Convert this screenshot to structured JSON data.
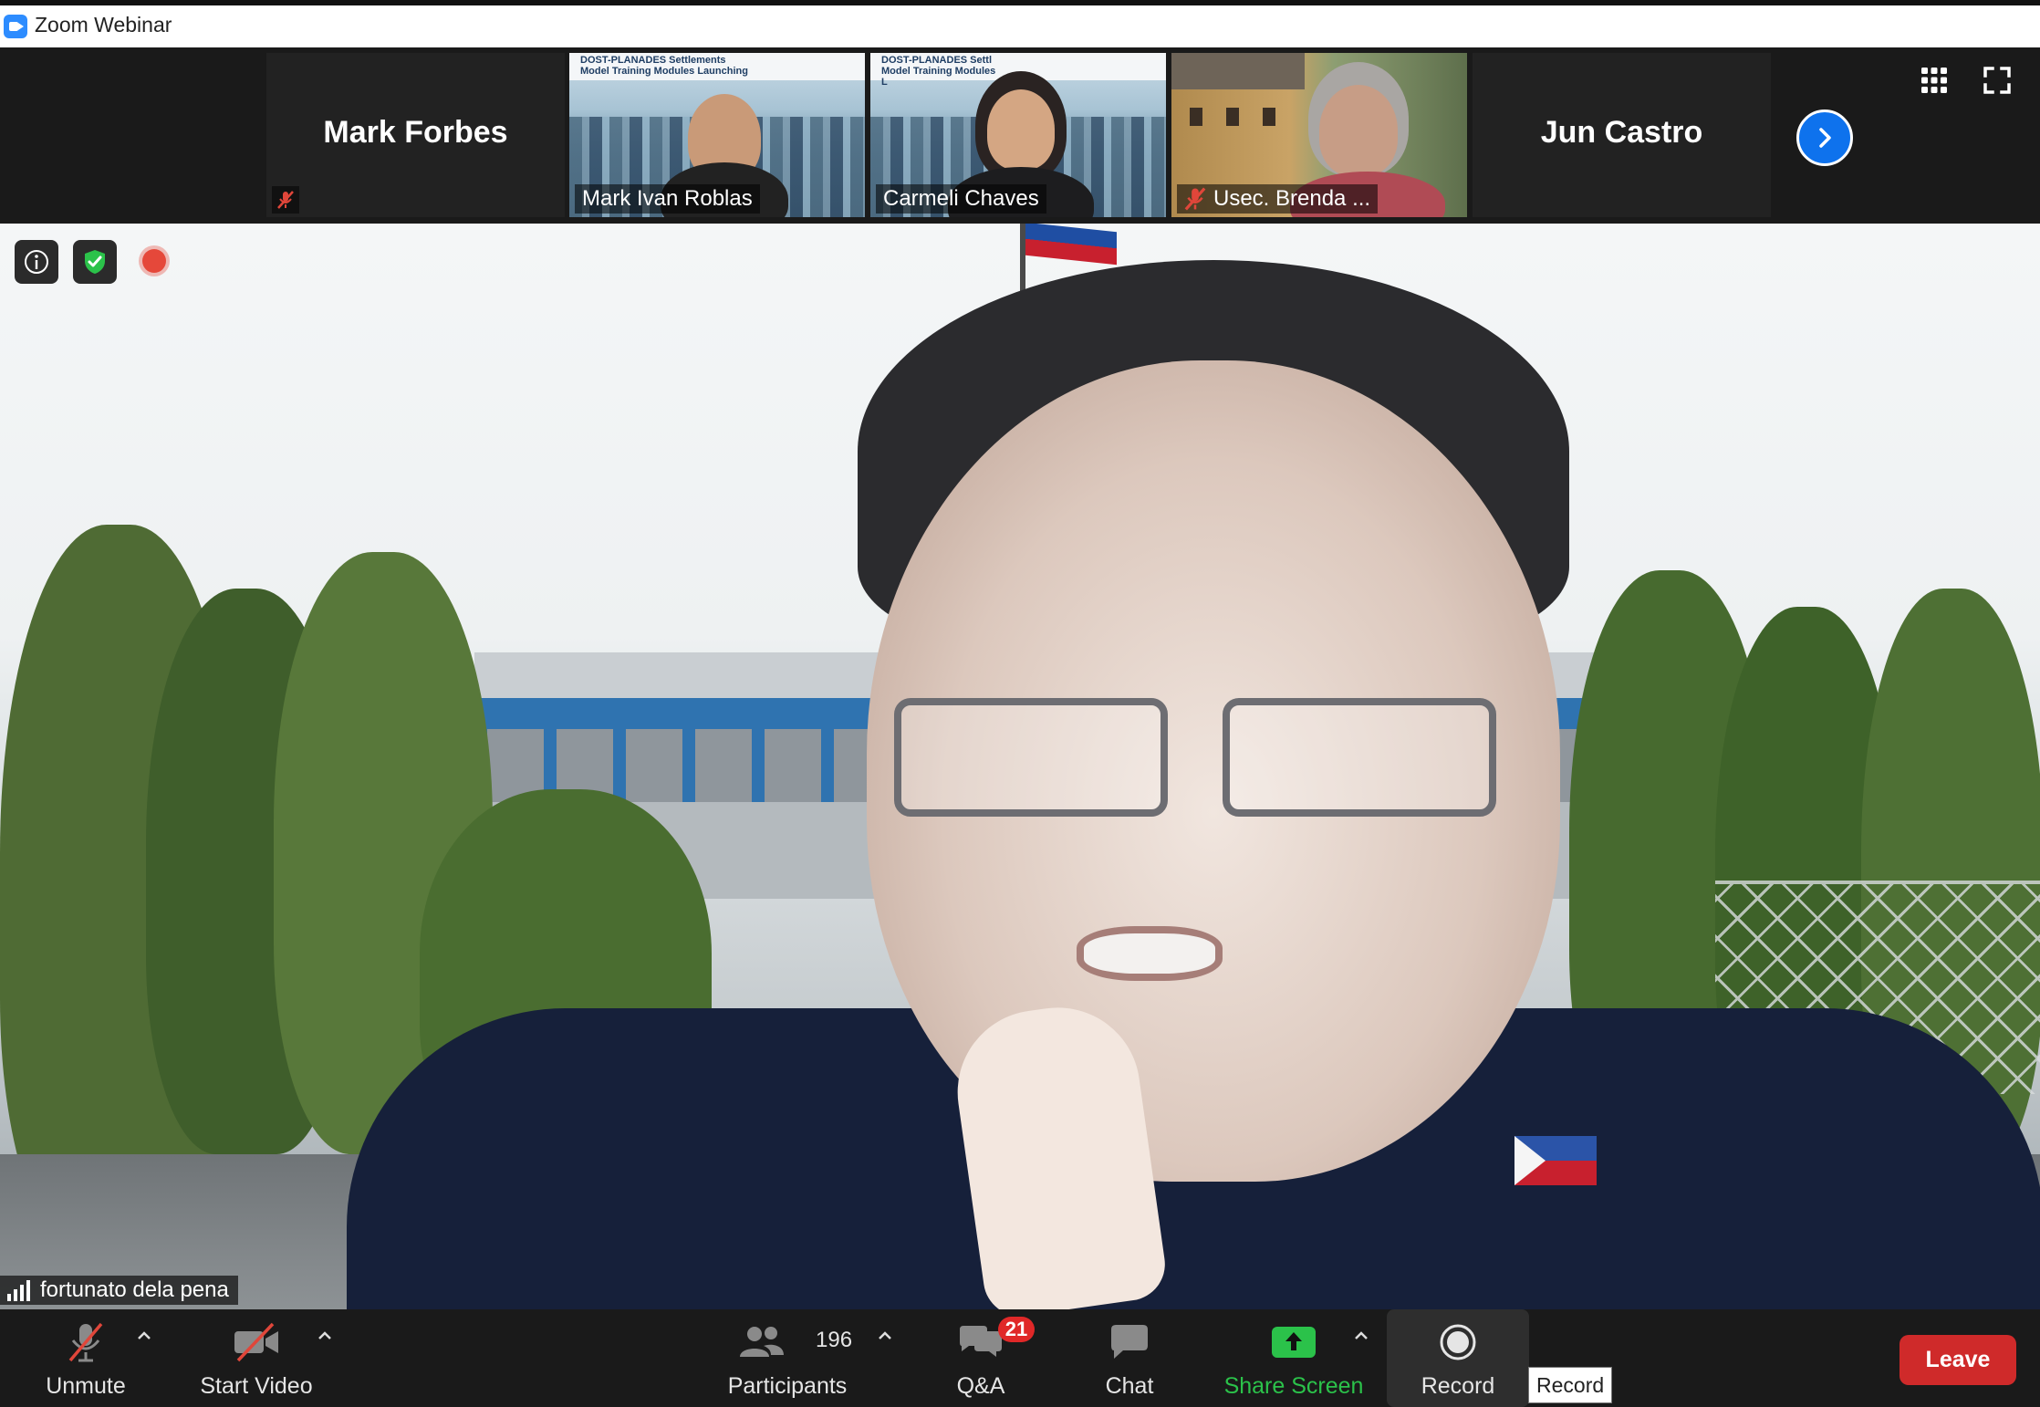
{
  "window": {
    "title": "Zoom Webinar"
  },
  "strip": {
    "tiles": [
      {
        "name": "Mark Forbes",
        "type": "name-only",
        "muted": true
      },
      {
        "name": "Mark Ivan Roblas",
        "type": "video",
        "muted": false
      },
      {
        "name": "Carmeli Chaves",
        "type": "video",
        "muted": false
      },
      {
        "name": "Usec. Brenda ...",
        "type": "video",
        "muted": true
      },
      {
        "name": "Jun Castro",
        "type": "name-only",
        "muted": false
      }
    ],
    "banner_text": "DOST-PLANADES Settlements Model Training Modules Launching",
    "banner_text_truncated": "DOST-PLANADES Settl Model Training Modules L"
  },
  "main_video": {
    "speaker_name": "fortunato dela pena"
  },
  "toolbar": {
    "unmute_label": "Unmute",
    "start_video_label": "Start Video",
    "participants_label": "Participants",
    "participants_count": "196",
    "qa_label": "Q&A",
    "qa_badge": "21",
    "chat_label": "Chat",
    "share_screen_label": "Share Screen",
    "record_label": "Record",
    "record_tooltip": "Record",
    "leave_label": "Leave"
  },
  "colors": {
    "accent_blue": "#0e72ed",
    "leave_red": "#cf2a2a",
    "share_green": "#2bc24a",
    "badge_red": "#e02828",
    "muted_red": "#e0463a"
  }
}
